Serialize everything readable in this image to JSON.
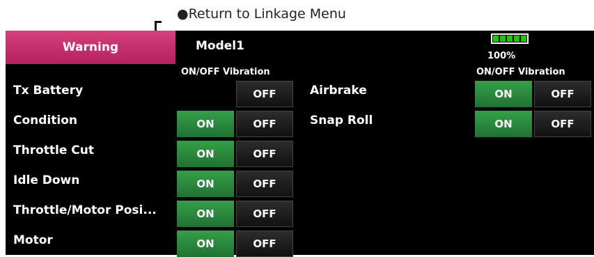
{
  "annotation": "●Return to Linkage Menu",
  "screen": {
    "tab_label": "Warning",
    "model_name": "Model1",
    "battery_percent": "100%",
    "header_left": "ON/OFF Vibration",
    "header_right": "ON/OFF Vibration",
    "left_items": [
      {
        "label": "Tx Battery",
        "on": "",
        "off": "OFF"
      },
      {
        "label": "Condition",
        "on": "ON",
        "off": "OFF"
      },
      {
        "label": "Throttle Cut",
        "on": "ON",
        "off": "OFF"
      },
      {
        "label": "Idle Down",
        "on": "ON",
        "off": "OFF"
      },
      {
        "label": "Throttle/Motor Posi...",
        "on": "ON",
        "off": "OFF"
      },
      {
        "label": "Motor",
        "on": "ON",
        "off": "OFF"
      }
    ],
    "right_items": [
      {
        "label": "Airbrake",
        "on": "ON",
        "off": "OFF"
      },
      {
        "label": "Snap Roll",
        "on": "ON",
        "off": "OFF"
      }
    ]
  },
  "colors": {
    "tab": "#c22f6a",
    "on": "#2a8a3c",
    "off": "#1a1a1a",
    "screen_bg": "#000000"
  }
}
